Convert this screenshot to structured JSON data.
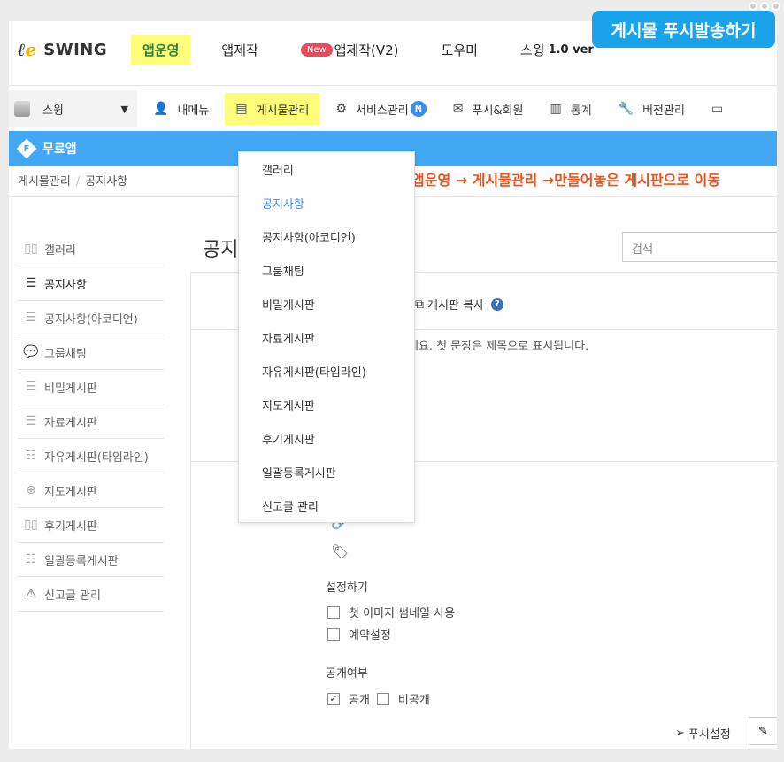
{
  "callout": "게시물 푸시발송하기",
  "logo": {
    "text": "SWING"
  },
  "topnav": {
    "items": [
      {
        "label": "앱운영"
      },
      {
        "label": "앱제작"
      },
      {
        "badge": "New",
        "label": "앱제작(V2)"
      },
      {
        "label": "도우미"
      },
      {
        "label": "스윙",
        "version": "1.0 ver"
      }
    ]
  },
  "app_select": {
    "label": "스윙",
    "caret": "▼"
  },
  "nav2": {
    "items": [
      {
        "label": "내메뉴",
        "icon": "user-icon"
      },
      {
        "label": "게시물관리",
        "icon": "list-icon"
      },
      {
        "label": "서비스관리",
        "icon": "gear-icon",
        "badge": "N"
      },
      {
        "label": "푸시&회원",
        "icon": "envelope-icon"
      },
      {
        "label": "통계",
        "icon": "bar-chart-icon"
      },
      {
        "label": "버전관리",
        "icon": "wrench-icon"
      }
    ]
  },
  "bluebar": {
    "icon_letter": "F",
    "label": "무료앱"
  },
  "breadcrumb": {
    "first": "게시물관리",
    "sep": "/",
    "second": "공지사항"
  },
  "annotation": "앱운영 → 게시물관리 →만들어놓은 게시판으로 이동",
  "sidebar": {
    "items": [
      {
        "label": "갤러리",
        "icon": "gallery-icon"
      },
      {
        "label": "공지사항",
        "icon": "notice-icon"
      },
      {
        "label": "공지사항(아코디언)",
        "icon": "accordion-icon"
      },
      {
        "label": "그룹채팅",
        "icon": "chat-icon"
      },
      {
        "label": "비밀게시판",
        "icon": "board-icon"
      },
      {
        "label": "자료게시판",
        "icon": "board-icon"
      },
      {
        "label": "자유게시판(타임라인)",
        "icon": "timeline-icon"
      },
      {
        "label": "지도게시판",
        "icon": "map-icon"
      },
      {
        "label": "후기게시판",
        "icon": "review-icon"
      },
      {
        "label": "일괄등록게시판",
        "icon": "bulk-icon"
      },
      {
        "label": "신고글 관리",
        "icon": "warning-icon"
      }
    ]
  },
  "content": {
    "title": "공지",
    "search_placeholder": "검색",
    "copy_label": "게시판 복사",
    "help": "?",
    "editor_placeholder": "세요. 첫 문장은 제목으로 표시됩니다.",
    "settings_title": "설정하기",
    "opt_thumbnail": "첫 이미지 썸네일 사용",
    "opt_reserve": "예약설정",
    "open_title": "공개여부",
    "opt_public": "공개",
    "opt_private": "비공개",
    "push_label": "푸시설정"
  },
  "dropdown": {
    "items": [
      {
        "label": "갤러리"
      },
      {
        "label": "공지사항"
      },
      {
        "label": "공지사항(아코디언)"
      },
      {
        "label": "그룹채팅"
      },
      {
        "label": "비밀게시판"
      },
      {
        "label": "자료게시판"
      },
      {
        "label": "자유게시판(타임라인)"
      },
      {
        "label": "지도게시판"
      },
      {
        "label": "후기게시판"
      },
      {
        "label": "일괄등록게시판"
      },
      {
        "label": "신고글 관리"
      }
    ],
    "active_index": 1
  },
  "colors": {
    "accent_blue": "#42a8f5",
    "highlight_yellow": "#fdfd7a",
    "annotation_orange": "#e8541c"
  }
}
